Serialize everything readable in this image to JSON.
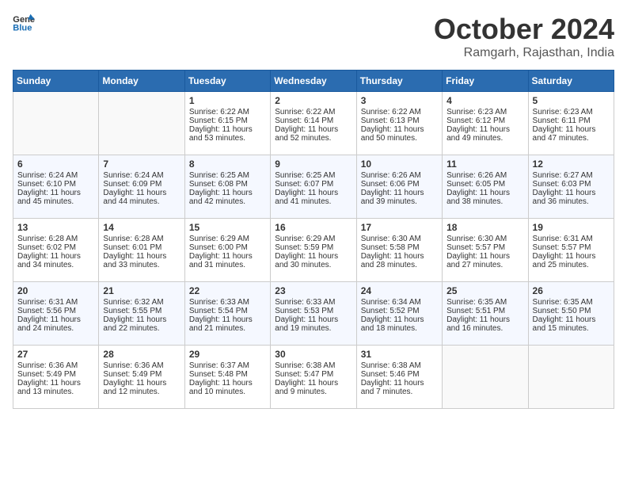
{
  "header": {
    "logo_general": "General",
    "logo_blue": "Blue",
    "month": "October 2024",
    "location": "Ramgarh, Rajasthan, India"
  },
  "weekdays": [
    "Sunday",
    "Monday",
    "Tuesday",
    "Wednesday",
    "Thursday",
    "Friday",
    "Saturday"
  ],
  "weeks": [
    [
      {
        "day": "",
        "sunrise": "",
        "sunset": "",
        "daylight": ""
      },
      {
        "day": "",
        "sunrise": "",
        "sunset": "",
        "daylight": ""
      },
      {
        "day": "1",
        "sunrise": "Sunrise: 6:22 AM",
        "sunset": "Sunset: 6:15 PM",
        "daylight": "Daylight: 11 hours and 53 minutes."
      },
      {
        "day": "2",
        "sunrise": "Sunrise: 6:22 AM",
        "sunset": "Sunset: 6:14 PM",
        "daylight": "Daylight: 11 hours and 52 minutes."
      },
      {
        "day": "3",
        "sunrise": "Sunrise: 6:22 AM",
        "sunset": "Sunset: 6:13 PM",
        "daylight": "Daylight: 11 hours and 50 minutes."
      },
      {
        "day": "4",
        "sunrise": "Sunrise: 6:23 AM",
        "sunset": "Sunset: 6:12 PM",
        "daylight": "Daylight: 11 hours and 49 minutes."
      },
      {
        "day": "5",
        "sunrise": "Sunrise: 6:23 AM",
        "sunset": "Sunset: 6:11 PM",
        "daylight": "Daylight: 11 hours and 47 minutes."
      }
    ],
    [
      {
        "day": "6",
        "sunrise": "Sunrise: 6:24 AM",
        "sunset": "Sunset: 6:10 PM",
        "daylight": "Daylight: 11 hours and 45 minutes."
      },
      {
        "day": "7",
        "sunrise": "Sunrise: 6:24 AM",
        "sunset": "Sunset: 6:09 PM",
        "daylight": "Daylight: 11 hours and 44 minutes."
      },
      {
        "day": "8",
        "sunrise": "Sunrise: 6:25 AM",
        "sunset": "Sunset: 6:08 PM",
        "daylight": "Daylight: 11 hours and 42 minutes."
      },
      {
        "day": "9",
        "sunrise": "Sunrise: 6:25 AM",
        "sunset": "Sunset: 6:07 PM",
        "daylight": "Daylight: 11 hours and 41 minutes."
      },
      {
        "day": "10",
        "sunrise": "Sunrise: 6:26 AM",
        "sunset": "Sunset: 6:06 PM",
        "daylight": "Daylight: 11 hours and 39 minutes."
      },
      {
        "day": "11",
        "sunrise": "Sunrise: 6:26 AM",
        "sunset": "Sunset: 6:05 PM",
        "daylight": "Daylight: 11 hours and 38 minutes."
      },
      {
        "day": "12",
        "sunrise": "Sunrise: 6:27 AM",
        "sunset": "Sunset: 6:03 PM",
        "daylight": "Daylight: 11 hours and 36 minutes."
      }
    ],
    [
      {
        "day": "13",
        "sunrise": "Sunrise: 6:28 AM",
        "sunset": "Sunset: 6:02 PM",
        "daylight": "Daylight: 11 hours and 34 minutes."
      },
      {
        "day": "14",
        "sunrise": "Sunrise: 6:28 AM",
        "sunset": "Sunset: 6:01 PM",
        "daylight": "Daylight: 11 hours and 33 minutes."
      },
      {
        "day": "15",
        "sunrise": "Sunrise: 6:29 AM",
        "sunset": "Sunset: 6:00 PM",
        "daylight": "Daylight: 11 hours and 31 minutes."
      },
      {
        "day": "16",
        "sunrise": "Sunrise: 6:29 AM",
        "sunset": "Sunset: 5:59 PM",
        "daylight": "Daylight: 11 hours and 30 minutes."
      },
      {
        "day": "17",
        "sunrise": "Sunrise: 6:30 AM",
        "sunset": "Sunset: 5:58 PM",
        "daylight": "Daylight: 11 hours and 28 minutes."
      },
      {
        "day": "18",
        "sunrise": "Sunrise: 6:30 AM",
        "sunset": "Sunset: 5:57 PM",
        "daylight": "Daylight: 11 hours and 27 minutes."
      },
      {
        "day": "19",
        "sunrise": "Sunrise: 6:31 AM",
        "sunset": "Sunset: 5:57 PM",
        "daylight": "Daylight: 11 hours and 25 minutes."
      }
    ],
    [
      {
        "day": "20",
        "sunrise": "Sunrise: 6:31 AM",
        "sunset": "Sunset: 5:56 PM",
        "daylight": "Daylight: 11 hours and 24 minutes."
      },
      {
        "day": "21",
        "sunrise": "Sunrise: 6:32 AM",
        "sunset": "Sunset: 5:55 PM",
        "daylight": "Daylight: 11 hours and 22 minutes."
      },
      {
        "day": "22",
        "sunrise": "Sunrise: 6:33 AM",
        "sunset": "Sunset: 5:54 PM",
        "daylight": "Daylight: 11 hours and 21 minutes."
      },
      {
        "day": "23",
        "sunrise": "Sunrise: 6:33 AM",
        "sunset": "Sunset: 5:53 PM",
        "daylight": "Daylight: 11 hours and 19 minutes."
      },
      {
        "day": "24",
        "sunrise": "Sunrise: 6:34 AM",
        "sunset": "Sunset: 5:52 PM",
        "daylight": "Daylight: 11 hours and 18 minutes."
      },
      {
        "day": "25",
        "sunrise": "Sunrise: 6:35 AM",
        "sunset": "Sunset: 5:51 PM",
        "daylight": "Daylight: 11 hours and 16 minutes."
      },
      {
        "day": "26",
        "sunrise": "Sunrise: 6:35 AM",
        "sunset": "Sunset: 5:50 PM",
        "daylight": "Daylight: 11 hours and 15 minutes."
      }
    ],
    [
      {
        "day": "27",
        "sunrise": "Sunrise: 6:36 AM",
        "sunset": "Sunset: 5:49 PM",
        "daylight": "Daylight: 11 hours and 13 minutes."
      },
      {
        "day": "28",
        "sunrise": "Sunrise: 6:36 AM",
        "sunset": "Sunset: 5:49 PM",
        "daylight": "Daylight: 11 hours and 12 minutes."
      },
      {
        "day": "29",
        "sunrise": "Sunrise: 6:37 AM",
        "sunset": "Sunset: 5:48 PM",
        "daylight": "Daylight: 11 hours and 10 minutes."
      },
      {
        "day": "30",
        "sunrise": "Sunrise: 6:38 AM",
        "sunset": "Sunset: 5:47 PM",
        "daylight": "Daylight: 11 hours and 9 minutes."
      },
      {
        "day": "31",
        "sunrise": "Sunrise: 6:38 AM",
        "sunset": "Sunset: 5:46 PM",
        "daylight": "Daylight: 11 hours and 7 minutes."
      },
      {
        "day": "",
        "sunrise": "",
        "sunset": "",
        "daylight": ""
      },
      {
        "day": "",
        "sunrise": "",
        "sunset": "",
        "daylight": ""
      }
    ]
  ]
}
